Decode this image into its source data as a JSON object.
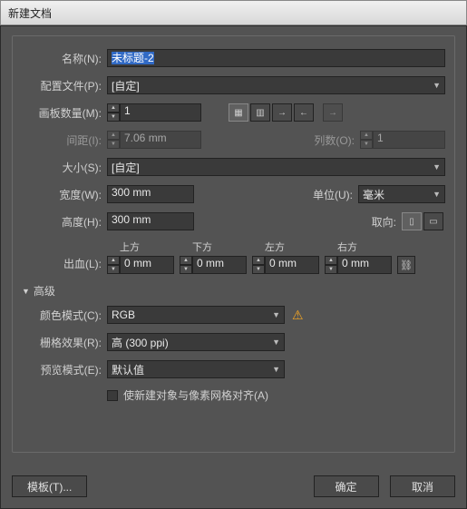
{
  "title": "新建文档",
  "name": {
    "label": "名称(N):",
    "value": "未标题-2"
  },
  "profile": {
    "label": "配置文件(P):",
    "value": "[自定]"
  },
  "artboards": {
    "label": "画板数量(M):",
    "value": "1"
  },
  "spacing": {
    "label": "间距(I):",
    "value": "7.06 mm"
  },
  "columns": {
    "label": "列数(O):",
    "value": "1"
  },
  "size": {
    "label": "大小(S):",
    "value": "[自定]"
  },
  "width": {
    "label": "宽度(W):",
    "value": "300 mm"
  },
  "units": {
    "label": "单位(U):",
    "value": "毫米"
  },
  "height": {
    "label": "高度(H):",
    "value": "300 mm"
  },
  "orient": {
    "label": "取向:"
  },
  "bleed": {
    "label": "出血(L):",
    "top": {
      "header": "上方",
      "value": "0 mm"
    },
    "bottom": {
      "header": "下方",
      "value": "0 mm"
    },
    "left": {
      "header": "左方",
      "value": "0 mm"
    },
    "right": {
      "header": "右方",
      "value": "0 mm"
    }
  },
  "advanced": "高级",
  "colormode": {
    "label": "颜色模式(C):",
    "value": "RGB"
  },
  "raster": {
    "label": "栅格效果(R):",
    "value": "高 (300 ppi)"
  },
  "preview": {
    "label": "预览模式(E):",
    "value": "默认值"
  },
  "align": "使新建对象与像素网格对齐(A)",
  "buttons": {
    "template": "模板(T)...",
    "ok": "确定",
    "cancel": "取消"
  }
}
